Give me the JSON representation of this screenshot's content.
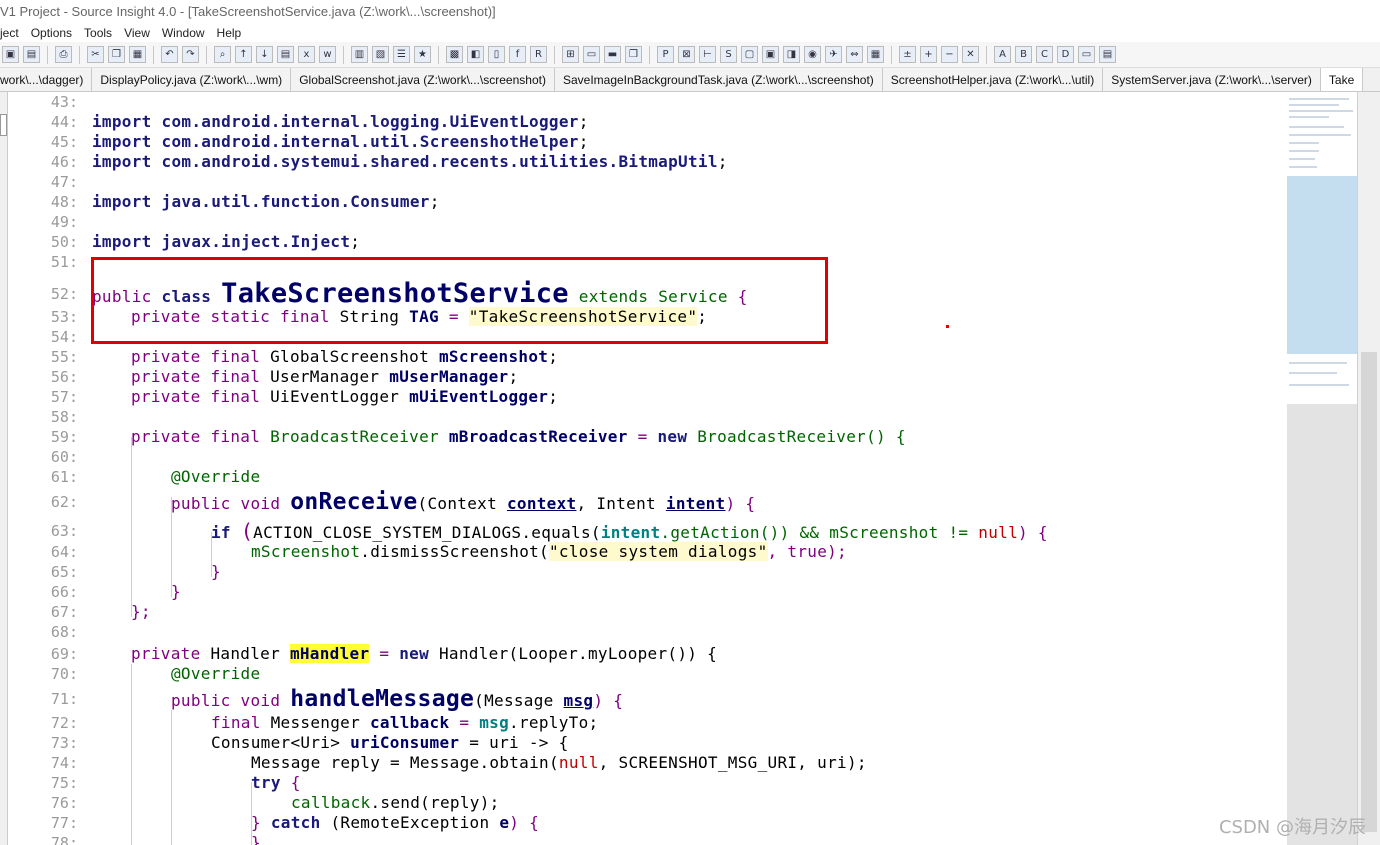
{
  "window": {
    "title": "V1 Project - Source Insight 4.0 - [TakeScreenshotService.java (Z:\\work\\...\\screenshot)]"
  },
  "menu": [
    "ject",
    "Options",
    "Tools",
    "View",
    "Window",
    "Help"
  ],
  "tabs": [
    {
      "label": "work\\...\\dagger)"
    },
    {
      "label": "DisplayPolicy.java (Z:\\work\\...\\wm)"
    },
    {
      "label": "GlobalScreenshot.java (Z:\\work\\...\\screenshot)"
    },
    {
      "label": "SaveImageInBackgroundTask.java (Z:\\work\\...\\screenshot)"
    },
    {
      "label": "ScreenshotHelper.java (Z:\\work\\...\\util)"
    },
    {
      "label": "SystemServer.java (Z:\\work\\...\\server)"
    },
    {
      "label": "Take"
    }
  ],
  "code": {
    "n43": "43:",
    "n44": "44:",
    "n45": "45:",
    "n46": "46:",
    "n47": "47:",
    "n48": "48:",
    "n49": "49:",
    "n50": "50:",
    "n51": "51:",
    "n52": "52:",
    "n53": "53:",
    "n54": "54:",
    "n55": "55:",
    "n56": "56:",
    "n57": "57:",
    "n58": "58:",
    "n59": "59:",
    "n60": "60:",
    "n61": "61:",
    "n62": "62:",
    "n63": "63:",
    "n64": "64:",
    "n65": "65:",
    "n66": "66:",
    "n67": "67:",
    "n68": "68:",
    "n69": "69:",
    "n70": "70:",
    "n71": "71:",
    "n72": "72:",
    "n73": "73:",
    "n74": "74:",
    "n75": "75:",
    "n76": "76:",
    "n77": "77:",
    "n78": "78:",
    "import": "import",
    "pkg44": "com.android.internal.logging.UiEventLogger",
    "pkg45": "com.android.internal.util.ScreenshotHelper",
    "pkg46": "com.android.systemui.shared.recents.utilities.BitmapUtil",
    "pkg48": "java.util.function.Consumer",
    "pkg50": "javax.inject.Inject",
    "semi": ";",
    "public": "public",
    "class": "class",
    "classname": "TakeScreenshotService",
    "extends": "extends",
    "service": "Service",
    "lbrace": "{",
    "private": "private",
    "static": "static",
    "final": "final",
    "string_type": "String",
    "tag": "TAG",
    "eq": "=",
    "tag_value": "\"TakeScreenshotService\"",
    "t_global": "GlobalScreenshot",
    "f_screenshot": "mScreenshot",
    "t_usermgr": "UserManager",
    "f_usermgr": "mUserManager",
    "t_uielog": "UiEventLogger",
    "f_uielog": "mUiEventLogger",
    "t_bcr": "BroadcastReceiver",
    "f_bcr": "mBroadcastReceiver",
    "new": "new",
    "bcr_ctor": "BroadcastReceiver() {",
    "override": "@Override",
    "void": "void",
    "onreceive": "onReceive",
    "p_context_t": "(Context ",
    "p_context": "context",
    "comma": ", ",
    "p_intent_t": "Intent ",
    "p_intent": "intent",
    "close_brace_paren": ") {",
    "if": "if",
    "l63_a": "(",
    "l63_b": "ACTION_CLOSE_SYSTEM_DIALOGS.equals(",
    "l63_intent": "intent",
    "l63_c": ".getAction()) && mScreenshot != ",
    "null": "null",
    "l63_d": ") {",
    "l64_a": "mScreenshot",
    "l64_b": ".dismissScreenshot(",
    "l64_str": "\"close system dialogs\"",
    "l64_c": ", true);",
    "rbrace": "}",
    "rbrace_semi": "};",
    "t_handler": "Handler",
    "f_handler": "mHandler",
    "l69_b": "Handler(Looper.myLooper()) {",
    "handlemessage": "handleMessage",
    "p_msg_t": "(Message ",
    "p_msg": "msg",
    "l72_t": "Messenger",
    "l72_f": "callback",
    "l72_msg": "msg",
    "l72_rest": ".replyTo;",
    "l73_t": "Consumer<Uri>",
    "l73_f": "uriConsumer",
    "l73_rest": "= uri -> {",
    "l74_a": "Message reply = Message.obtain(",
    "l74_b": ", SCREENSHOT_MSG_URI, uri);",
    "try": "try",
    "l76_a": "callback",
    "l76_b": ".send(reply);",
    "catch": "catch",
    "l77_b": "(RemoteException ",
    "l77_e": "e",
    "l77_c": ") {",
    "l78": "}"
  },
  "watermark": "CSDN @海月汐辰",
  "colors": {
    "highlight_box": "#e00000",
    "selection": "#9cc6e4"
  }
}
